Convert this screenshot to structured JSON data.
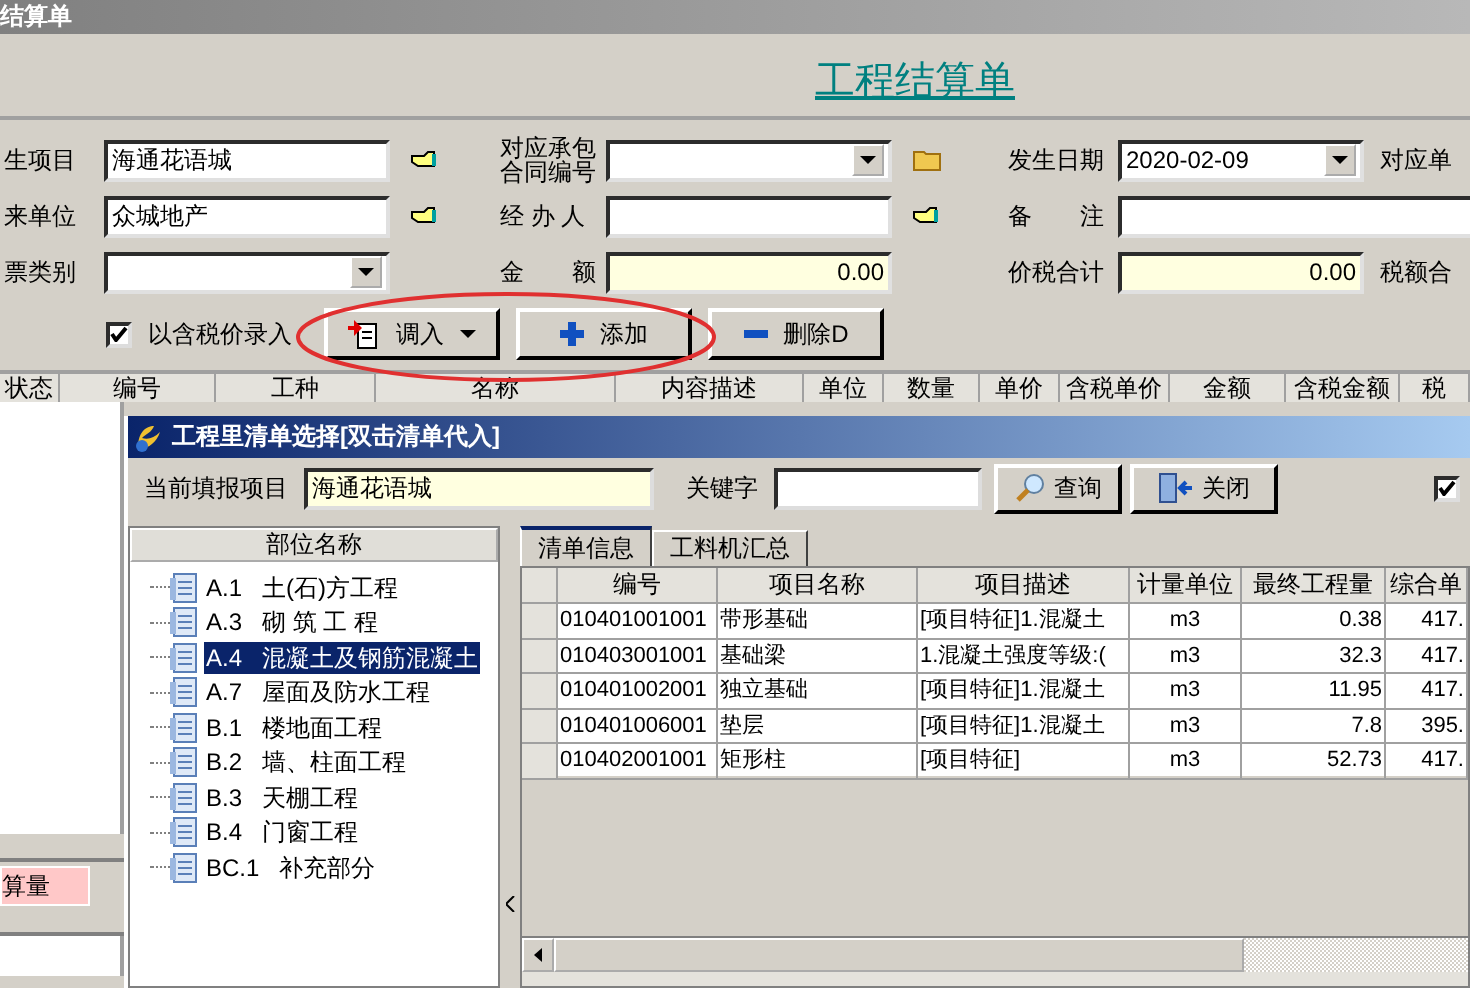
{
  "window": {
    "title": "结算单"
  },
  "form": {
    "heading": "工程结算单",
    "rows": [
      {
        "cells": [
          {
            "kind": "label",
            "text": "生项目"
          },
          {
            "kind": "text",
            "value": "海通花语城"
          },
          {
            "kind": "hand"
          },
          {
            "kind": "label",
            "text": "对应承包合同编号"
          },
          {
            "kind": "combo"
          },
          {
            "kind": "folder"
          },
          {
            "kind": "label",
            "text": "发生日期"
          },
          {
            "kind": "combo",
            "value": "2020-02-09"
          },
          {
            "kind": "edge-label",
            "text": "对应单"
          }
        ]
      },
      {
        "cells": [
          {
            "kind": "label",
            "text": "来单位"
          },
          {
            "kind": "text",
            "value": "众城地产"
          },
          {
            "kind": "hand"
          },
          {
            "kind": "label",
            "text": "经 办 人"
          },
          {
            "kind": "text"
          },
          {
            "kind": "hand"
          },
          {
            "kind": "label",
            "text": "备　　注"
          },
          {
            "kind": "wide"
          },
          null
        ]
      },
      {
        "cells": [
          {
            "kind": "label",
            "text": "票类别"
          },
          {
            "kind": "combo"
          },
          null,
          {
            "kind": "label",
            "text": "金　　额"
          },
          {
            "kind": "amount",
            "value": "0.00"
          },
          null,
          {
            "kind": "label",
            "text": "价税合计"
          },
          {
            "kind": "amount",
            "value": "0.00"
          },
          {
            "kind": "edge-label",
            "text": "税额合"
          }
        ]
      }
    ],
    "tax_checkbox": {
      "label": "以含税价录入",
      "checked": true
    },
    "buttons": [
      {
        "label": "调入"
      },
      {
        "label": "添加"
      },
      {
        "label": "删除D"
      }
    ]
  },
  "table": {
    "columns": [
      "状态",
      "编号",
      "工种",
      "名称",
      "内容描述",
      "单位",
      "数量",
      "单价",
      "含税单价",
      "金额",
      "含税金额",
      "税"
    ]
  },
  "side_panel": {
    "tag": "算量"
  },
  "dialog": {
    "title": "工程里清单选择[双击清单代入]",
    "project_label": "当前填报项目",
    "project_value": "海通花语城",
    "keyword_label": "关键字",
    "search_button": "查询",
    "close_button": "关闭",
    "option_checked": true,
    "tree": {
      "header": "部位名称",
      "items": [
        {
          "code": "A.1",
          "name": "土(石)方工程",
          "selected": false
        },
        {
          "code": "A.3",
          "name": "砌 筑 工 程",
          "selected": false
        },
        {
          "code": "A.4",
          "name": "混凝土及钢筋混凝土",
          "selected": true
        },
        {
          "code": "A.7",
          "name": "屋面及防水工程",
          "selected": false
        },
        {
          "code": "B.1",
          "name": "楼地面工程",
          "selected": false
        },
        {
          "code": "B.2",
          "name": "墙、柱面工程",
          "selected": false
        },
        {
          "code": "B.3",
          "name": "天棚工程",
          "selected": false
        },
        {
          "code": "B.4",
          "name": "门窗工程",
          "selected": false
        },
        {
          "code": "BC.1",
          "name": "补充部分",
          "selected": false
        }
      ]
    },
    "tabs": [
      {
        "label": "清单信息",
        "selected": true
      },
      {
        "label": "工料机汇总",
        "selected": false
      }
    ],
    "grid": {
      "columns": [
        "编号",
        "项目名称",
        "项目描述",
        "计量单位",
        "最终工程量",
        "综合单"
      ],
      "rows": [
        [
          "010401001001",
          "带形基础",
          "[项目特征]1.混凝土",
          "m3",
          "0.38",
          "417."
        ],
        [
          "010403001001",
          "基础梁",
          "1.混凝土强度等级:(",
          "m3",
          "32.3",
          "417."
        ],
        [
          "010401002001",
          "独立基础",
          "[项目特征]1.混凝土",
          "m3",
          "11.95",
          "417."
        ],
        [
          "010401006001",
          "垫层",
          "[项目特征]1.混凝土",
          "m3",
          "7.8",
          "395."
        ],
        [
          "010402001001",
          "矩形柱",
          "[项目特征]",
          "m3",
          "52.73",
          "417."
        ]
      ]
    }
  }
}
